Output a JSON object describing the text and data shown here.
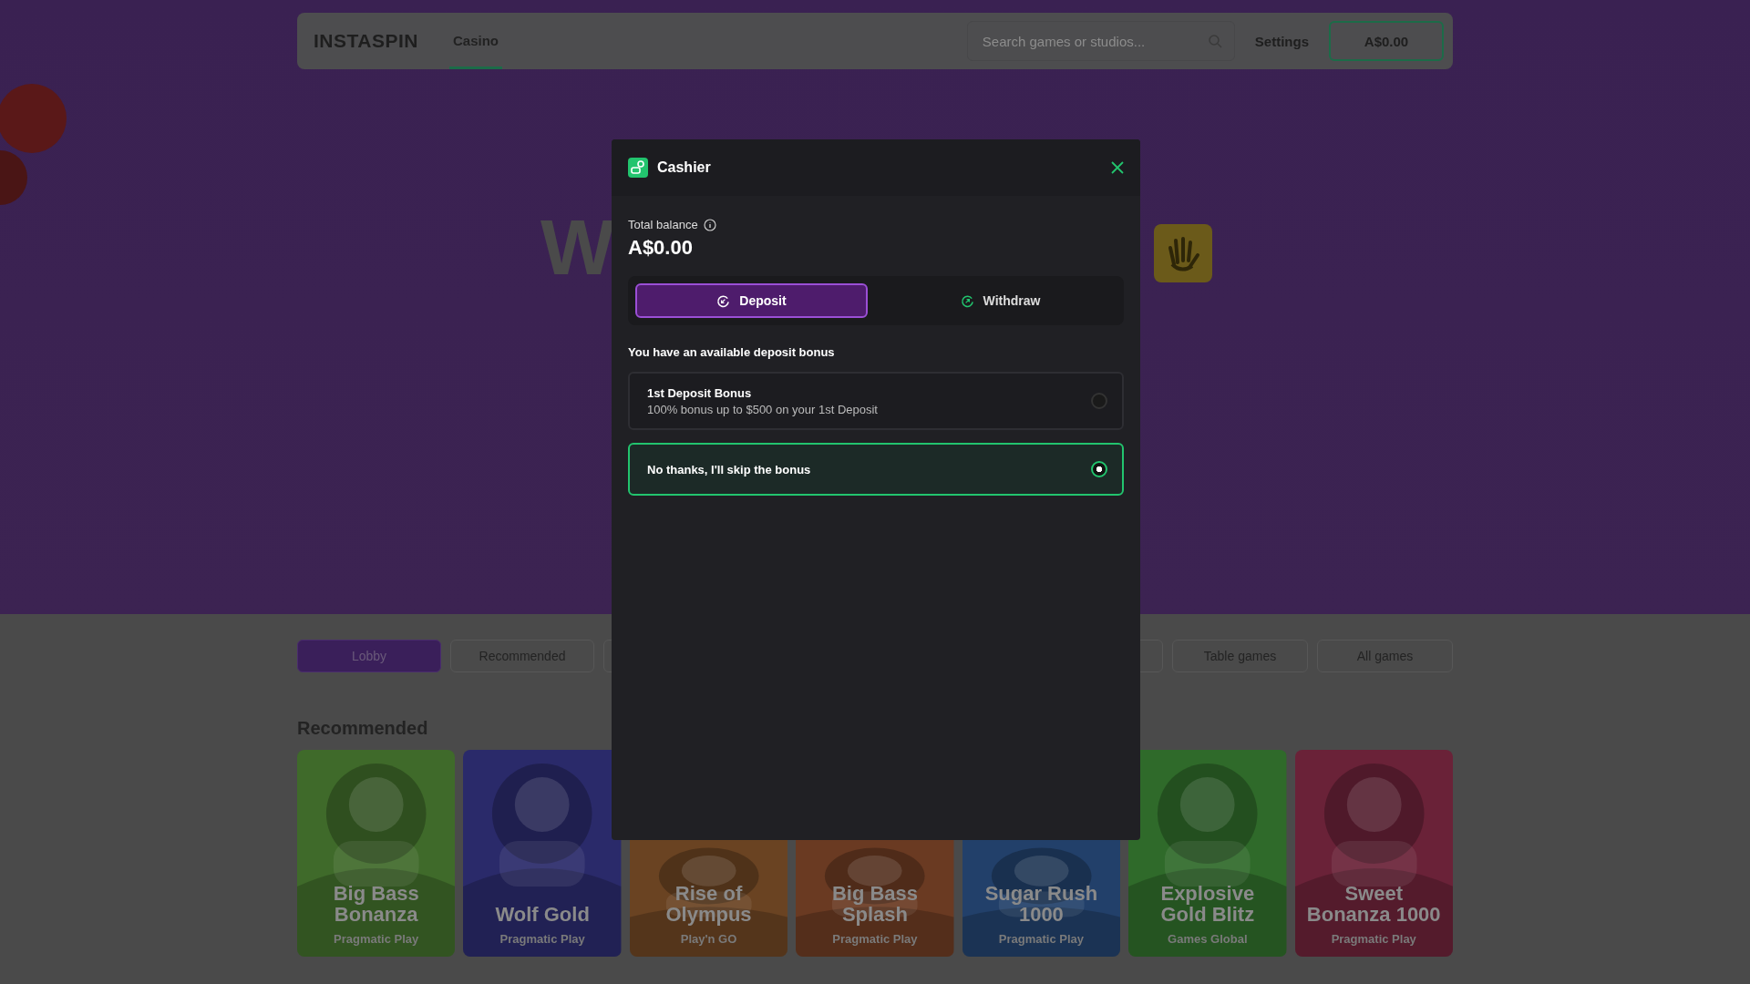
{
  "header": {
    "logo": "INSTASPIN",
    "nav": [
      {
        "label": "Casino",
        "selected": true
      }
    ],
    "search": {
      "placeholder": "Search games or studios..."
    },
    "settings": "Settings",
    "balance": "A$0.00"
  },
  "hero": {
    "heading": "W"
  },
  "categories": [
    {
      "kind": "tab",
      "label": "Lobby",
      "selected": true
    },
    {
      "kind": "tab",
      "label": "Recommended",
      "selected": false
    },
    {
      "kind": "covered"
    },
    {
      "kind": "covered"
    },
    {
      "kind": "tab",
      "label": "Table games",
      "selected": false
    },
    {
      "kind": "tab",
      "label": "All games",
      "selected": false
    }
  ],
  "section_title": "Recommended",
  "games": [
    {
      "title": "Big Bass Bonanza",
      "studio": "Pragmatic Play",
      "color": "#3f6a2a"
    },
    {
      "title": "Wolf Gold",
      "studio": "Pragmatic Play",
      "color": "#2a2a6a"
    },
    {
      "title": "Rise of Olympus",
      "studio": "Play'n GO",
      "color": "#6a4322"
    },
    {
      "title": "Big Bass Splash",
      "studio": "Pragmatic Play",
      "color": "#6a3a22"
    },
    {
      "title": "Sugar Rush 1000",
      "studio": "Pragmatic Play",
      "color": "#22406a"
    },
    {
      "title": "Explosive Gold Blitz",
      "studio": "Games Global",
      "color": "#2f6a2a"
    },
    {
      "title": "Sweet Bonanza 1000",
      "studio": "Pragmatic Play",
      "color": "#6a2238"
    }
  ],
  "cashier": {
    "title": "Cashier",
    "balance_label": "Total balance",
    "balance": "A$0.00",
    "tabs": [
      {
        "label": "Deposit",
        "selected": true
      },
      {
        "label": "Withdraw",
        "selected": false
      }
    ],
    "bonus_heading": "You have an available deposit bonus",
    "options": [
      {
        "title": "1st Deposit Bonus",
        "description": "100% bonus up to $500 on your 1st Deposit",
        "selected": false
      },
      {
        "title": "No thanks, I'll skip the bonus",
        "selected": true
      }
    ]
  }
}
